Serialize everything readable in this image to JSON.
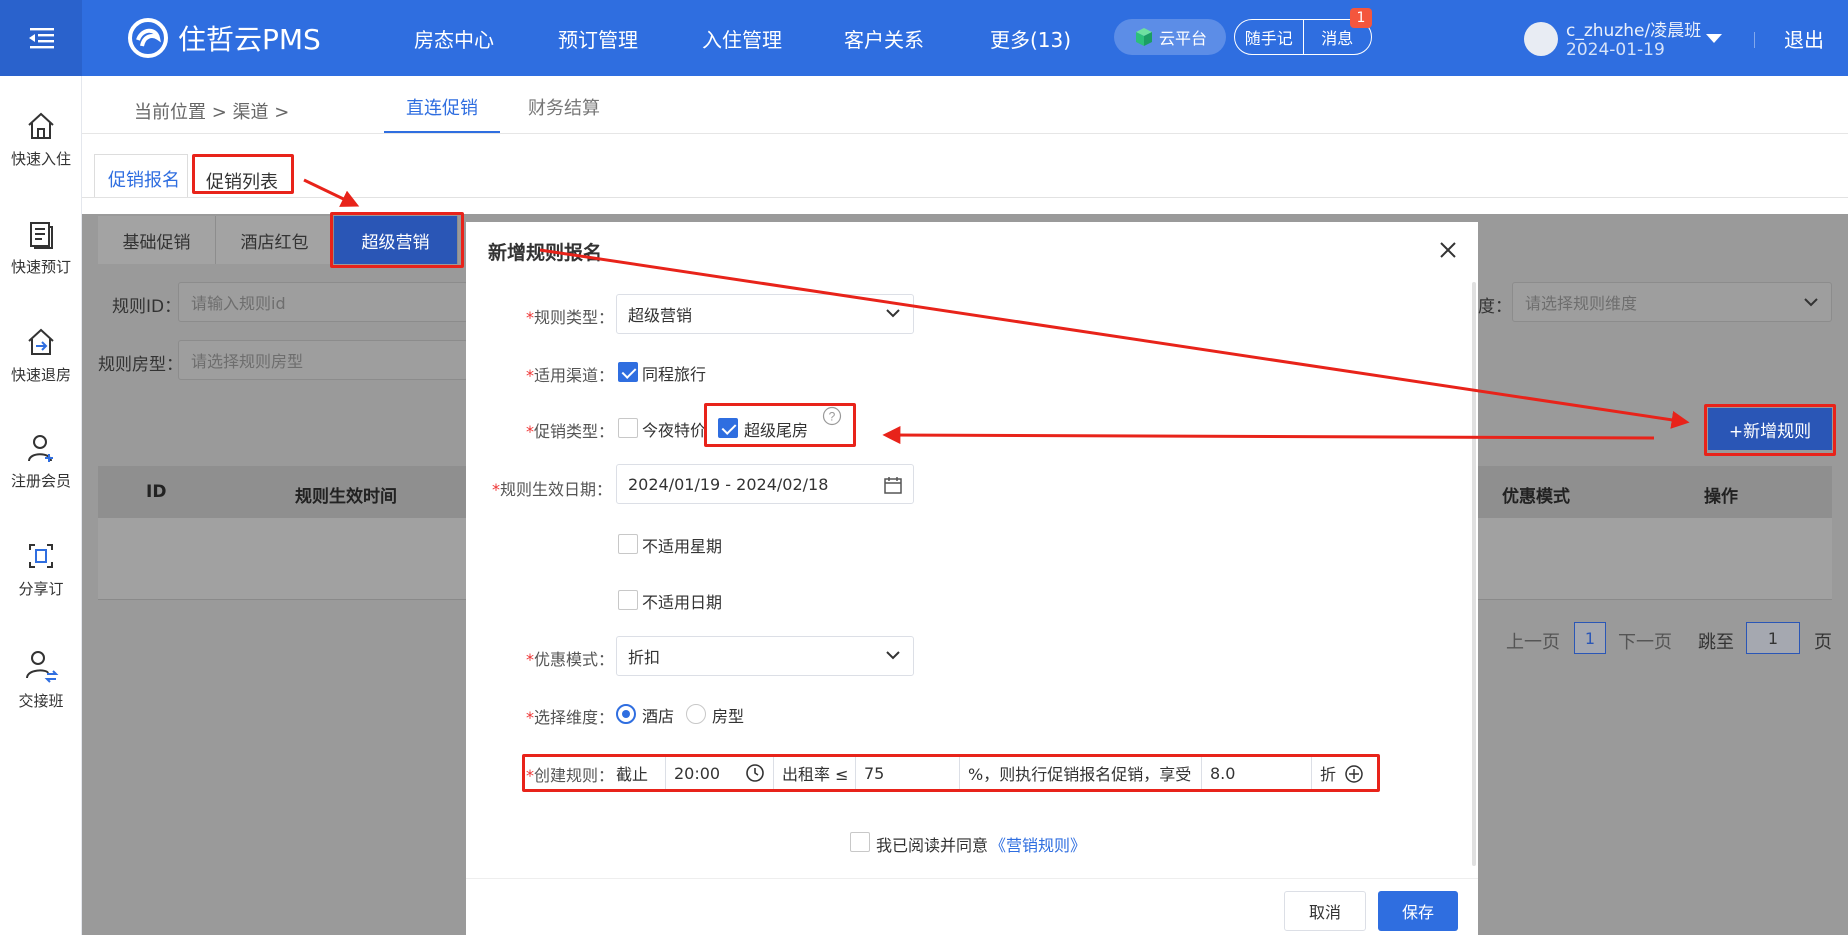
{
  "header": {
    "logo_text": "住哲云PMS",
    "nav": [
      "房态中心",
      "预订管理",
      "入住管理",
      "客户关系",
      "更多(13)"
    ],
    "cloud_label": "云平台",
    "note_label": "随手记",
    "msg_label": "消息",
    "msg_badge": "1",
    "user_name": "c_zhuzhe/凌晨班",
    "user_date": "2024-01-19",
    "logout": "退出"
  },
  "sidebar": [
    "快速入住",
    "快速预订",
    "快速退房",
    "注册会员",
    "分享订",
    "交接班"
  ],
  "breadcrumb": {
    "text": "当前位置 > 渠道 >",
    "tabs": [
      "直连促销",
      "财务结算"
    ]
  },
  "subtabs": [
    "促销报名",
    "促销列表"
  ],
  "segments": [
    "基础促销",
    "酒店红包",
    "超级营销"
  ],
  "filters": {
    "rule_id_label": "规则ID：",
    "rule_id_placeholder": "请输入规则id",
    "room_type_label": "规则房型：",
    "room_type_placeholder": "请选择规则房型",
    "dimension_label": "度：",
    "dimension_placeholder": "请选择规则维度"
  },
  "add_rule_label": "+新增规则",
  "table": {
    "headers": [
      "ID",
      "规则生效时间",
      "优惠模式",
      "操作"
    ]
  },
  "pager": {
    "prev": "上一页",
    "page": "1",
    "next": "下一页",
    "jump_label": "跳至",
    "jump_value": "1",
    "page_unit": "页"
  },
  "modal": {
    "title": "新增规则报名",
    "rule_type_label": "规则类型：",
    "rule_type_value": "超级营销",
    "channel_label": "适用渠道：",
    "channel_value": "同程旅行",
    "promo_type_label": "促销类型：",
    "promo_option_1": "今夜特价",
    "promo_option_2": "超级尾房",
    "date_label": "规则生效日期：",
    "date_value": "2024/01/19 - 2024/02/18",
    "not_weekday": "不适用星期",
    "not_date": "不适用日期",
    "discount_label": "优惠模式：",
    "discount_value": "折扣",
    "dimension_label": "选择维度：",
    "dimension_opt1": "酒店",
    "dimension_opt2": "房型",
    "create_rule_label": "创建规则：",
    "cutoff_label": "截止",
    "cutoff_time": "20:00",
    "occupancy_label": "出租率 ≤",
    "occupancy_value": "75",
    "rule_middle_text": "%，则执行促销报名促销，享受",
    "discount_rate": "8.0",
    "discount_unit": "折",
    "agree_text": "我已阅读并同意",
    "agree_link": "《营销规则》",
    "cancel": "取消",
    "save": "保存"
  },
  "colors": {
    "brand": "#2f6ee0",
    "annotation": "#e8231a"
  }
}
